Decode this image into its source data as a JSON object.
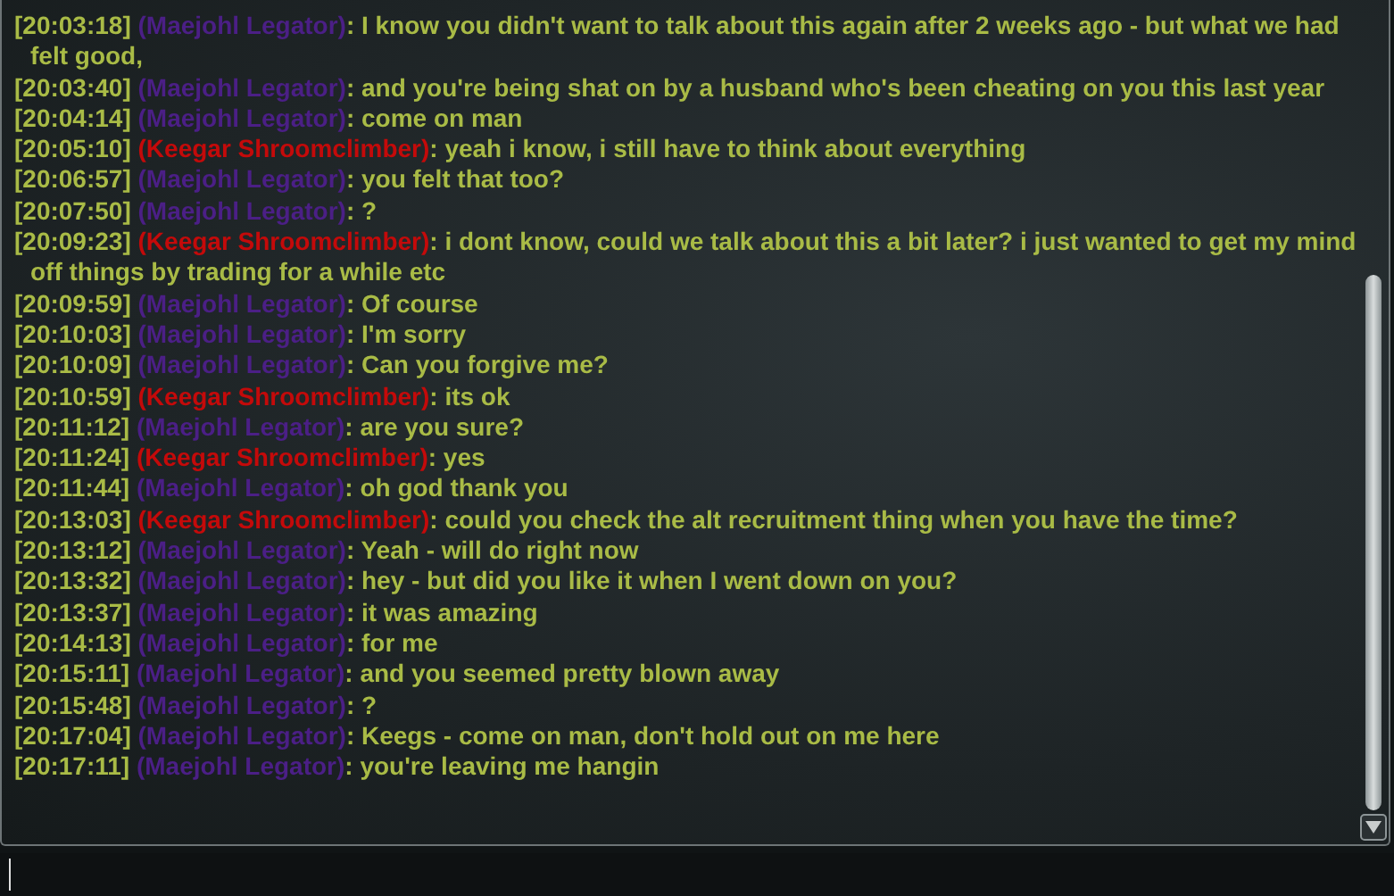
{
  "chat": {
    "messages": [
      {
        "time": "[20:03:18]",
        "speaker": "(Maejohl Legator)",
        "color": "#4b1f86",
        "text": ": I know you didn't want to talk about this again after 2 weeks ago - but what we had felt good,"
      },
      {
        "time": "[20:03:40]",
        "speaker": "(Maejohl Legator)",
        "color": "#4b1f86",
        "text": ": and you're being shat on by a husband who's been cheating on you this last year"
      },
      {
        "time": "[20:04:14]",
        "speaker": "(Maejohl Legator)",
        "color": "#4b1f86",
        "text": ": come on man"
      },
      {
        "time": "[20:05:10]",
        "speaker": "(Keegar Shroomclimber)",
        "color": "#c40a0a",
        "text": ": yeah i know, i still have to think about everything"
      },
      {
        "time": "[20:06:57]",
        "speaker": "(Maejohl Legator)",
        "color": "#4b1f86",
        "text": ": you felt that too?"
      },
      {
        "time": "[20:07:50]",
        "speaker": "(Maejohl Legator)",
        "color": "#4b1f86",
        "text": ": ?"
      },
      {
        "time": "[20:09:23]",
        "speaker": "(Keegar Shroomclimber)",
        "color": "#c40a0a",
        "text": ": i dont know, could we talk about this a bit later? i just wanted to get my mind off things by trading for a while etc"
      },
      {
        "time": "[20:09:59]",
        "speaker": "(Maejohl Legator)",
        "color": "#4b1f86",
        "text": ": Of course"
      },
      {
        "time": "[20:10:03]",
        "speaker": "(Maejohl Legator)",
        "color": "#4b1f86",
        "text": ": I'm sorry"
      },
      {
        "time": "[20:10:09]",
        "speaker": "(Maejohl Legator)",
        "color": "#4b1f86",
        "text": ": Can you forgive me?"
      },
      {
        "time": "[20:10:59]",
        "speaker": "(Keegar Shroomclimber)",
        "color": "#c40a0a",
        "text": ": its ok"
      },
      {
        "time": "[20:11:12]",
        "speaker": "(Maejohl Legator)",
        "color": "#4b1f86",
        "text": ": are you sure?"
      },
      {
        "time": "[20:11:24]",
        "speaker": "(Keegar Shroomclimber)",
        "color": "#c40a0a",
        "text": ": yes"
      },
      {
        "time": "[20:11:44]",
        "speaker": "(Maejohl Legator)",
        "color": "#4b1f86",
        "text": ": oh god thank you"
      },
      {
        "time": "[20:13:03]",
        "speaker": "(Keegar Shroomclimber)",
        "color": "#c40a0a",
        "text": ": could you check the alt recruitment thing when you have the time?"
      },
      {
        "time": "[20:13:12]",
        "speaker": "(Maejohl Legator)",
        "color": "#4b1f86",
        "text": ": Yeah - will do right now"
      },
      {
        "time": "[20:13:32]",
        "speaker": "(Maejohl Legator)",
        "color": "#4b1f86",
        "text": ": hey - but did you like it when I went down on you?"
      },
      {
        "time": "[20:13:37]",
        "speaker": "(Maejohl Legator)",
        "color": "#4b1f86",
        "text": ": it was amazing"
      },
      {
        "time": "[20:14:13]",
        "speaker": "(Maejohl Legator)",
        "color": "#4b1f86",
        "text": ": for me"
      },
      {
        "time": "[20:15:11]",
        "speaker": "(Maejohl Legator)",
        "color": "#4b1f86",
        "text": ": and you seemed pretty blown away"
      },
      {
        "time": "[20:15:48]",
        "speaker": "(Maejohl Legator)",
        "color": "#4b1f86",
        "text": ": ?"
      },
      {
        "time": "[20:17:04]",
        "speaker": "(Maejohl Legator)",
        "color": "#4b1f86",
        "text": ": Keegs - come on man, don't hold out on me here"
      },
      {
        "time": "[20:17:11]",
        "speaker": "(Maejohl Legator)",
        "color": "#4b1f86",
        "text": ": you're leaving me hangin"
      }
    ]
  }
}
